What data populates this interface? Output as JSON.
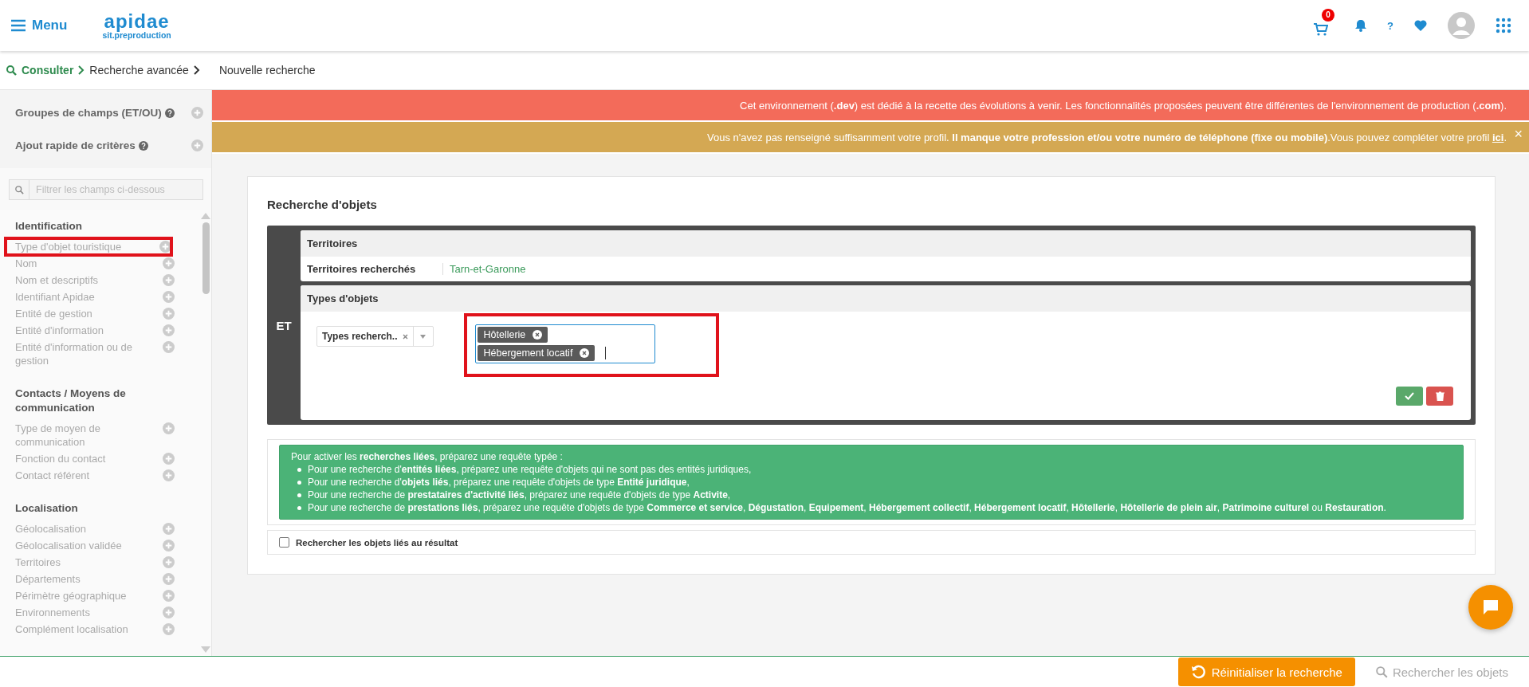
{
  "header": {
    "menu_label": "Menu",
    "logo": {
      "name": "apidae",
      "subtitle": "sit.preproduction"
    },
    "cart_count": "0",
    "help_label": "?"
  },
  "breadcrumb": [
    {
      "label": "Consulter",
      "kind": "root"
    },
    {
      "label": "Recherche avancée",
      "kind": "link"
    },
    {
      "label": "Nouvelle recherche",
      "kind": "current"
    }
  ],
  "sidebar": {
    "groups": [
      {
        "label": "Groupes de champs (ET/OU)"
      },
      {
        "label": "Ajout rapide de critères"
      }
    ],
    "filter": {
      "placeholder": "Filtrer les champs ci-dessous"
    },
    "sections": [
      {
        "title": "Identification",
        "items": [
          {
            "label": "Type d'objet touristique",
            "highlighted": true
          },
          {
            "label": "Nom",
            "highlighted": false
          },
          {
            "label": "Nom et descriptifs",
            "highlighted": false
          },
          {
            "label": "Identifiant Apidae",
            "highlighted": false
          },
          {
            "label": "Entité de gestion",
            "highlighted": false
          },
          {
            "label": "Entité d'information",
            "highlighted": false
          },
          {
            "label": "Entité d'information ou de gestion",
            "highlighted": false
          }
        ]
      },
      {
        "title": "Contacts / Moyens de communication",
        "items": [
          {
            "label": "Type de moyen de communication",
            "highlighted": false
          },
          {
            "label": "Fonction du contact",
            "highlighted": false
          },
          {
            "label": "Contact référent",
            "highlighted": false
          }
        ]
      },
      {
        "title": "Localisation",
        "items": [
          {
            "label": "Géolocalisation",
            "highlighted": false
          },
          {
            "label": "Géolocalisation validée",
            "highlighted": false
          },
          {
            "label": "Territoires",
            "highlighted": false
          },
          {
            "label": "Départements",
            "highlighted": false
          },
          {
            "label": "Périmètre géographique",
            "highlighted": false
          },
          {
            "label": "Environnements",
            "highlighted": false
          },
          {
            "label": "Complément localisation",
            "highlighted": false
          }
        ]
      }
    ]
  },
  "banners": [
    {
      "kind": "danger",
      "text": "Cet environnement (**.dev**) est dédié à la recette des évolutions à venir. Les fonctionnalités proposées peuvent être différentes de l'environnement de production (**.com**)."
    },
    {
      "kind": "warning",
      "text": "Vous n'avez pas renseigné suffisamment votre profil. **Il manque votre profession et/ou votre numéro de téléphone (fixe ou mobile)**.Vous pouvez compléter votre profil ",
      "link": "ici",
      "after": ".",
      "close": "×"
    }
  ],
  "search": {
    "title": "Recherche d'objets",
    "operator": "ET",
    "blocks": [
      {
        "kind": "rows",
        "title": "Territoires",
        "rows": [
          {
            "label": "Territoires recherchés",
            "value": "Tarn-et-Garonne"
          }
        ]
      },
      {
        "kind": "tags",
        "title": "Types d'objets",
        "select": "Types recherch..",
        "tags": [
          "Hôtellerie",
          "Hébergement locatif"
        ],
        "highlighted": true
      }
    ]
  },
  "info": {
    "intro": "Pour activer les **recherches liées**, préparez une requête typée :",
    "items": [
      "Pour une recherche d'**entités liées**, préparez une requête d'objets qui ne sont pas des entités juridiques,",
      "Pour une recherche d'**objets liés**, préparez une requête d'objets de type **Entité juridique**,",
      "Pour une recherche de **prestataires d'activité liés**, préparez une requête d'objets de type **Activite**,",
      "Pour une recherche de **prestations liés**, préparez une requête d'objets de type **Commerce et service**, **Dégustation**, **Equipement**, **Hébergement collectif**, **Hébergement locatif**, **Hôtellerie**, **Hôtellerie de plein air**, **Patrimoine culturel** ou **Restauration**."
    ]
  },
  "linked_checkbox": {
    "label": "Rechercher les objets liés au résultat",
    "checked": false
  },
  "footer": {
    "reset": {
      "label": "Réinitialiser la recherche",
      "disabled": false
    },
    "search": {
      "label": "Rechercher les objets",
      "disabled": true
    }
  }
}
